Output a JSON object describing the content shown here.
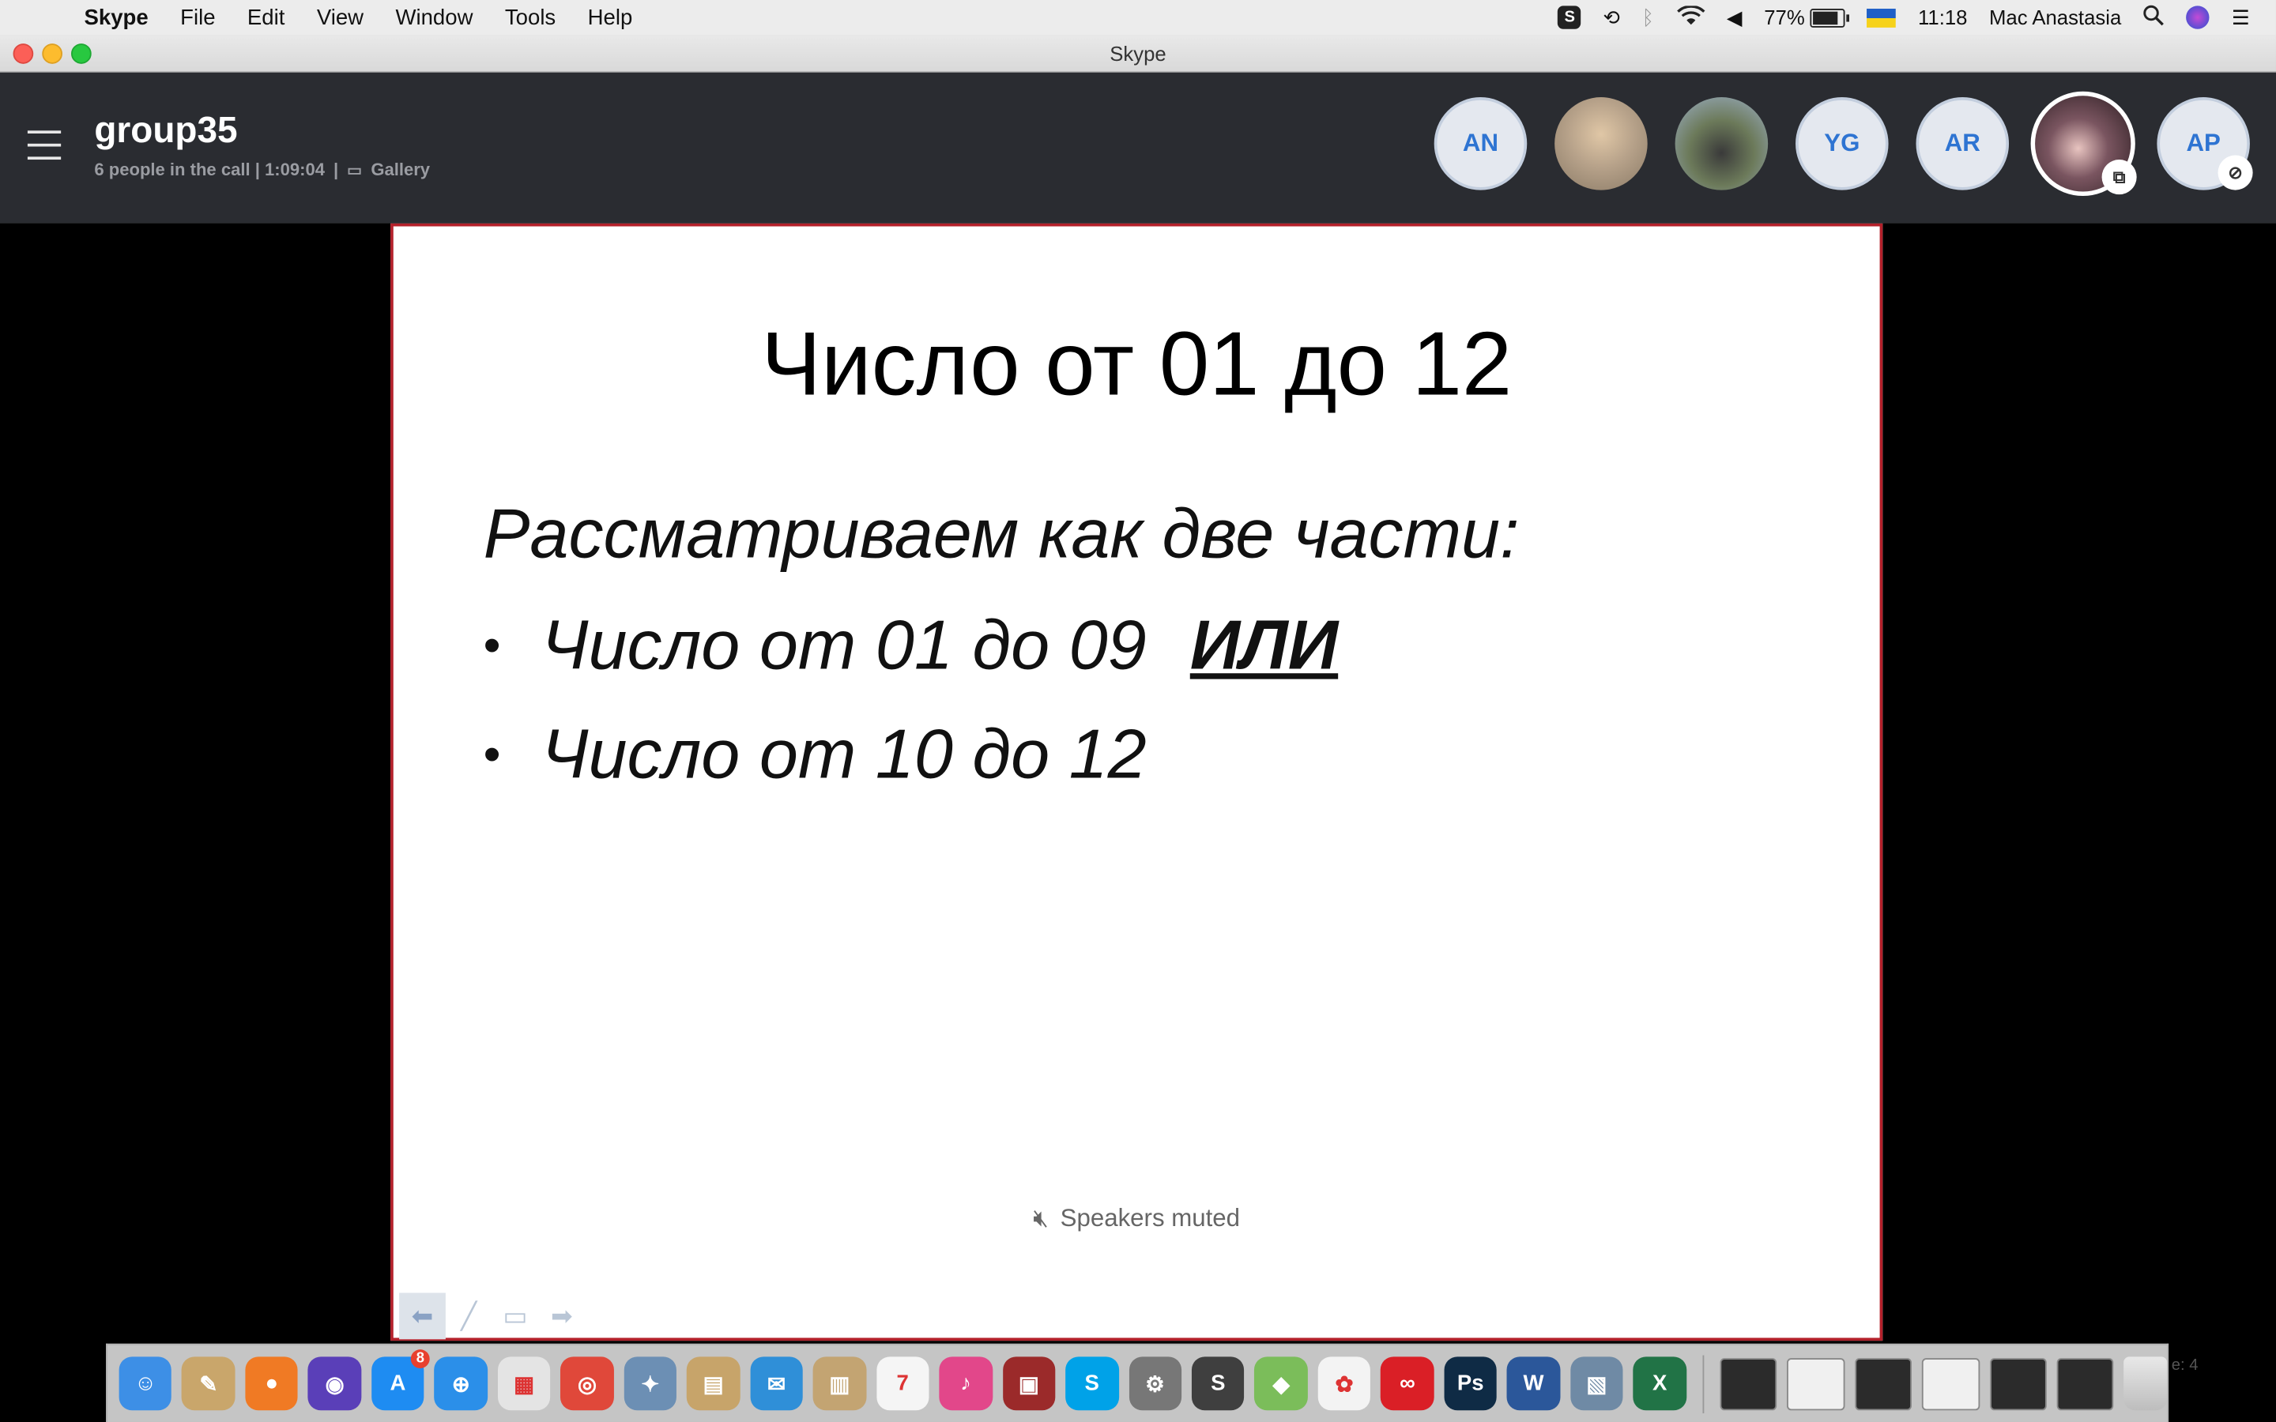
{
  "menubar": {
    "app_name": "Skype",
    "items": [
      "File",
      "Edit",
      "View",
      "Window",
      "Tools",
      "Help"
    ],
    "battery_percent": "77%",
    "battery_level": 0.77,
    "time": "11:18",
    "user": "Mac Anastasia"
  },
  "window": {
    "title": "Skype"
  },
  "call": {
    "group_name": "group35",
    "people": "6 people in the call | 1:09:04",
    "separator": "|",
    "view_mode": "Gallery"
  },
  "participants": [
    {
      "initials": "AN",
      "kind": "initials"
    },
    {
      "initials": "",
      "kind": "photo",
      "color": "#b7a28a"
    },
    {
      "initials": "",
      "kind": "photo",
      "color": "#6c7a5a"
    },
    {
      "initials": "YG",
      "kind": "initials"
    },
    {
      "initials": "AR",
      "kind": "initials"
    },
    {
      "initials": "",
      "kind": "photo",
      "color": "#3b2a2e",
      "badge": "screen-share"
    },
    {
      "initials": "AP",
      "kind": "initials",
      "badge": "mic-muted"
    }
  ],
  "slide": {
    "title": "Число от 01 до 12",
    "lead": "Рассматриваем как две части:",
    "bullets": [
      {
        "text": "Число от 01 до 09",
        "emphasis": "ИЛИ"
      },
      {
        "text": "Число от 10 до 12",
        "emphasis": ""
      }
    ],
    "bullet_char": "•"
  },
  "status": {
    "speakers": "Speakers muted"
  },
  "dock": {
    "apps": [
      {
        "name": "Finder",
        "color": "#3d8fe6",
        "glyph": "☺"
      },
      {
        "name": "TextEdit",
        "color": "#c9a66b",
        "glyph": "✎"
      },
      {
        "name": "Origin",
        "color": "#f07a24",
        "glyph": "●"
      },
      {
        "name": "Siri",
        "color": "#5a3fb8",
        "glyph": "◉"
      },
      {
        "name": "App Store",
        "color": "#1e8cf2",
        "glyph": "A",
        "badge": "8"
      },
      {
        "name": "Safari",
        "color": "#2b8fe9",
        "glyph": "⊕"
      },
      {
        "name": "Launchpad",
        "color": "#e4e4e4",
        "glyph": "▦"
      },
      {
        "name": "Chrome",
        "color": "#e0483a",
        "glyph": "◎"
      },
      {
        "name": "Preview",
        "color": "#6c8fb4",
        "glyph": "✦"
      },
      {
        "name": "Archive",
        "color": "#c7a46a",
        "glyph": "▤"
      },
      {
        "name": "Airmail",
        "color": "#2f8fd8",
        "glyph": "✉"
      },
      {
        "name": "Notes",
        "color": "#c3a472",
        "glyph": "▥"
      },
      {
        "name": "Calendar",
        "color": "#f5f5f5",
        "glyph": "7"
      },
      {
        "name": "iTunes",
        "color": "#e2478a",
        "glyph": "♪"
      },
      {
        "name": "Photo Booth",
        "color": "#9b2a2a",
        "glyph": "▣"
      },
      {
        "name": "Skype",
        "color": "#00a2e8",
        "glyph": "S"
      },
      {
        "name": "System Preferences",
        "color": "#777",
        "glyph": "⚙"
      },
      {
        "name": "Sublime Text",
        "color": "#3f3f3f",
        "glyph": "S"
      },
      {
        "name": "Maps",
        "color": "#7bbd5a",
        "glyph": "◆"
      },
      {
        "name": "Photos",
        "color": "#f3f3f3",
        "glyph": "✿"
      },
      {
        "name": "Creative Cloud",
        "color": "#da1f26",
        "glyph": "∞"
      },
      {
        "name": "Photoshop",
        "color": "#0f2b45",
        "glyph": "Ps"
      },
      {
        "name": "Word",
        "color": "#2b579a",
        "glyph": "W"
      },
      {
        "name": "Preview 2",
        "color": "#6f8aa5",
        "glyph": "▧"
      },
      {
        "name": "Excel",
        "color": "#217346",
        "glyph": "X"
      }
    ],
    "recent": [
      {
        "name": "Window 1",
        "color": "#2b2b2b"
      },
      {
        "name": "Window 2",
        "color": "#f0f0f0"
      },
      {
        "name": "Window 3",
        "color": "#2b2b2b"
      },
      {
        "name": "Window 4",
        "color": "#f0f0f0"
      },
      {
        "name": "Window 5",
        "color": "#2b2b2b"
      },
      {
        "name": "Window 6",
        "color": "#2b2b2b"
      }
    ],
    "trash": "Trash"
  },
  "peek_text": "e: 4"
}
